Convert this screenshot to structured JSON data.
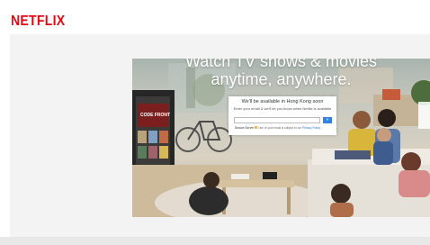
{
  "header": {
    "logo_text": "NETFLIX"
  },
  "colors": {
    "brand": "#e50914",
    "cta": "#3182e0"
  },
  "hero": {
    "title_line1": "Watch TV shows & movies",
    "title_line2": "anytime, anywhere.",
    "tv_text": "CODE FRONT"
  },
  "signup_card": {
    "heading": "We'll be available in Hong Kong soon",
    "subtext": "Enter your email & we'll let you know when Netflix is available",
    "email_placeholder": "",
    "submit_label": "»",
    "note_prefix": "Secure Server",
    "note_middle": "Use of your email is subject to our",
    "note_link": "Privacy Policy"
  }
}
